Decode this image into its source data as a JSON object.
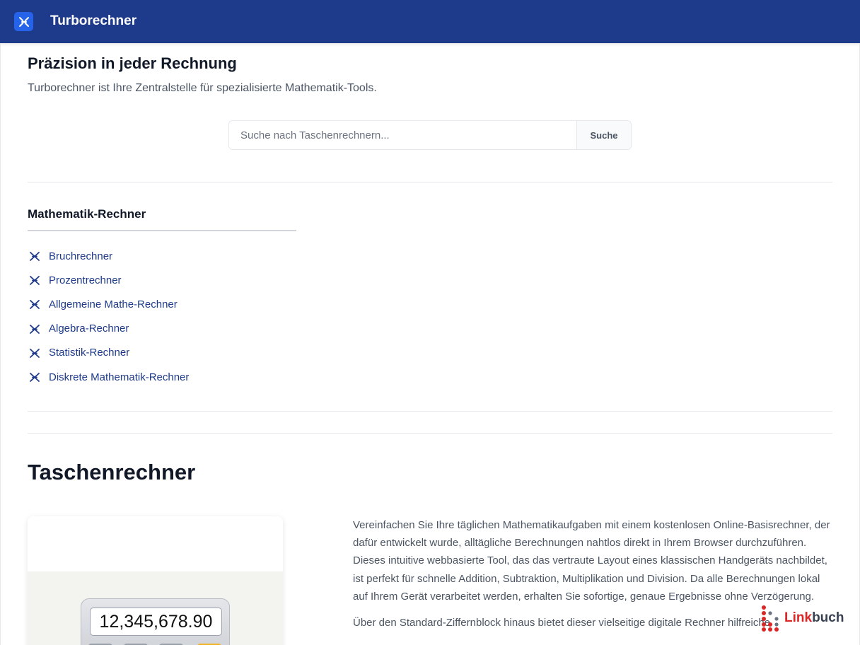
{
  "header": {
    "app_name": "Turborechner",
    "logo_icon": "calculator-logo-icon",
    "accent": "#1e3a8a"
  },
  "hero": {
    "title": "Präzision in jeder Rechnung",
    "subtitle": "Turborechner ist Ihre Zentralstelle für spezialisierte Mathematik-Tools."
  },
  "search": {
    "placeholder": "Suche nach Taschenrechnern...",
    "value": "",
    "button_label": "Suche"
  },
  "category": {
    "title": "Mathematik-Rechner",
    "items": [
      {
        "label": "Bruchrechner",
        "icon": "calculator-icon"
      },
      {
        "label": "Prozentrechner",
        "icon": "calculator-icon"
      },
      {
        "label": "Allgemeine Mathe-Rechner",
        "icon": "calculator-icon"
      },
      {
        "label": "Algebra-Rechner",
        "icon": "calculator-icon"
      },
      {
        "label": "Statistik-Rechner",
        "icon": "calculator-icon"
      },
      {
        "label": "Diskrete Mathematik-Rechner",
        "icon": "calculator-icon"
      }
    ]
  },
  "section": {
    "title": "Taschenrechner",
    "calculator_display": "12,345,678.90",
    "paragraphs": [
      "Vereinfachen Sie Ihre täglichen Mathematikaufgaben mit einem kostenlosen Online-Basisrechner, der dafür entwickelt wurde, alltägliche Berechnungen nahtlos direkt in Ihrem Browser durchzuführen. Dieses intuitive webbasierte Tool, das das vertraute Layout eines klassischen Handgeräts nachbildet, ist perfekt für schnelle Addition, Subtraktion, Multiplikation und Division. Da alle Berechnungen lokal auf Ihrem Gerät verarbeitet werden, erhalten Sie sofortige, genaue Ergebnisse ohne Verzögerung.",
      "Über den Standard-Ziffernblock hinaus bietet dieser vielseitige digitale Rechner hilfreiche"
    ]
  },
  "watermark": {
    "text_a": "Link",
    "text_b": "buch"
  }
}
